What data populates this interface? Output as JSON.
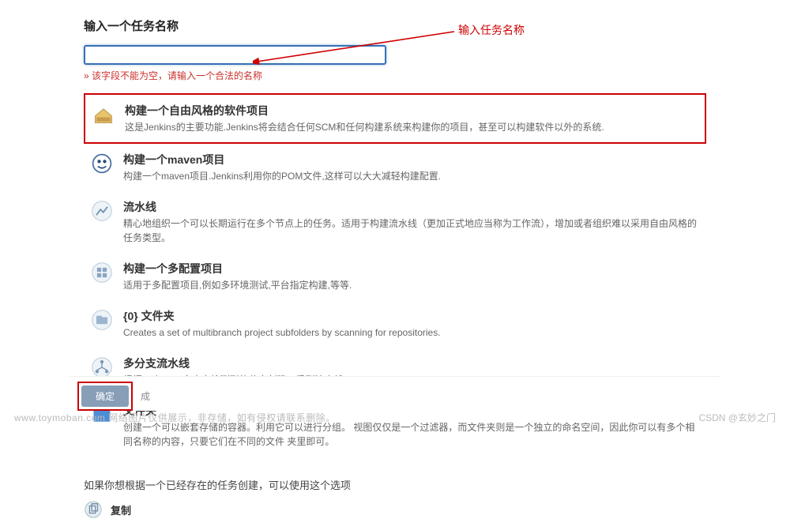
{
  "header": {
    "title": "输入一个任务名称",
    "input_value": "",
    "error": "» 该字段不能为空，请输入一个合法的名称"
  },
  "items": [
    {
      "icon": "freestyle-icon",
      "title": "构建一个自由风格的软件项目",
      "desc": "这是Jenkins的主要功能.Jenkins将会结合任何SCM和任何构建系统来构建你的项目，甚至可以构建软件以外的系统.",
      "highlight": true
    },
    {
      "icon": "maven-icon",
      "title": "构建一个maven项目",
      "desc": "构建一个maven项目.Jenkins利用你的POM文件,这样可以大大减轻构建配置."
    },
    {
      "icon": "pipeline-icon",
      "title": "流水线",
      "desc": "精心地组织一个可以长期运行在多个节点上的任务。适用于构建流水线（更加正式地应当称为工作流），增加或者组织难以采用自由风格的任务类型。"
    },
    {
      "icon": "multiconfig-icon",
      "title": "构建一个多配置项目",
      "desc": "适用于多配置项目,例如多环境测试,平台指定构建,等等."
    },
    {
      "icon": "folder-scan-icon",
      "title": "{0} 文件夹",
      "desc": "Creates a set of multibranch project subfolders by scanning for repositories."
    },
    {
      "icon": "multibranch-icon",
      "title": "多分支流水线",
      "desc": "根据一个SCM仓库中检测到的分支创建一系列流水线。"
    },
    {
      "icon": "folder-icon",
      "title": "文件夹",
      "desc": "创建一个可以嵌套存储的容器。利用它可以进行分组。 视图仅仅是一个过滤器，而文件夹则是一个独立的命名空间，因此你可以有多个相同名称的内容，只要它们在不同的文件 夹里即可。"
    }
  ],
  "copy": {
    "prompt": "如果你想根据一个已经存在的任务创建，可以使用这个选项",
    "icon": "copy-icon",
    "label": "复制"
  },
  "footer": {
    "ok": "确定",
    "hint": "成"
  },
  "annotation": "输入任务名称",
  "watermark": "www.toymoban.com 网络图片仅供展示，非存储，如有侵权请联系删除。",
  "credit": "CSDN @玄妙之门"
}
